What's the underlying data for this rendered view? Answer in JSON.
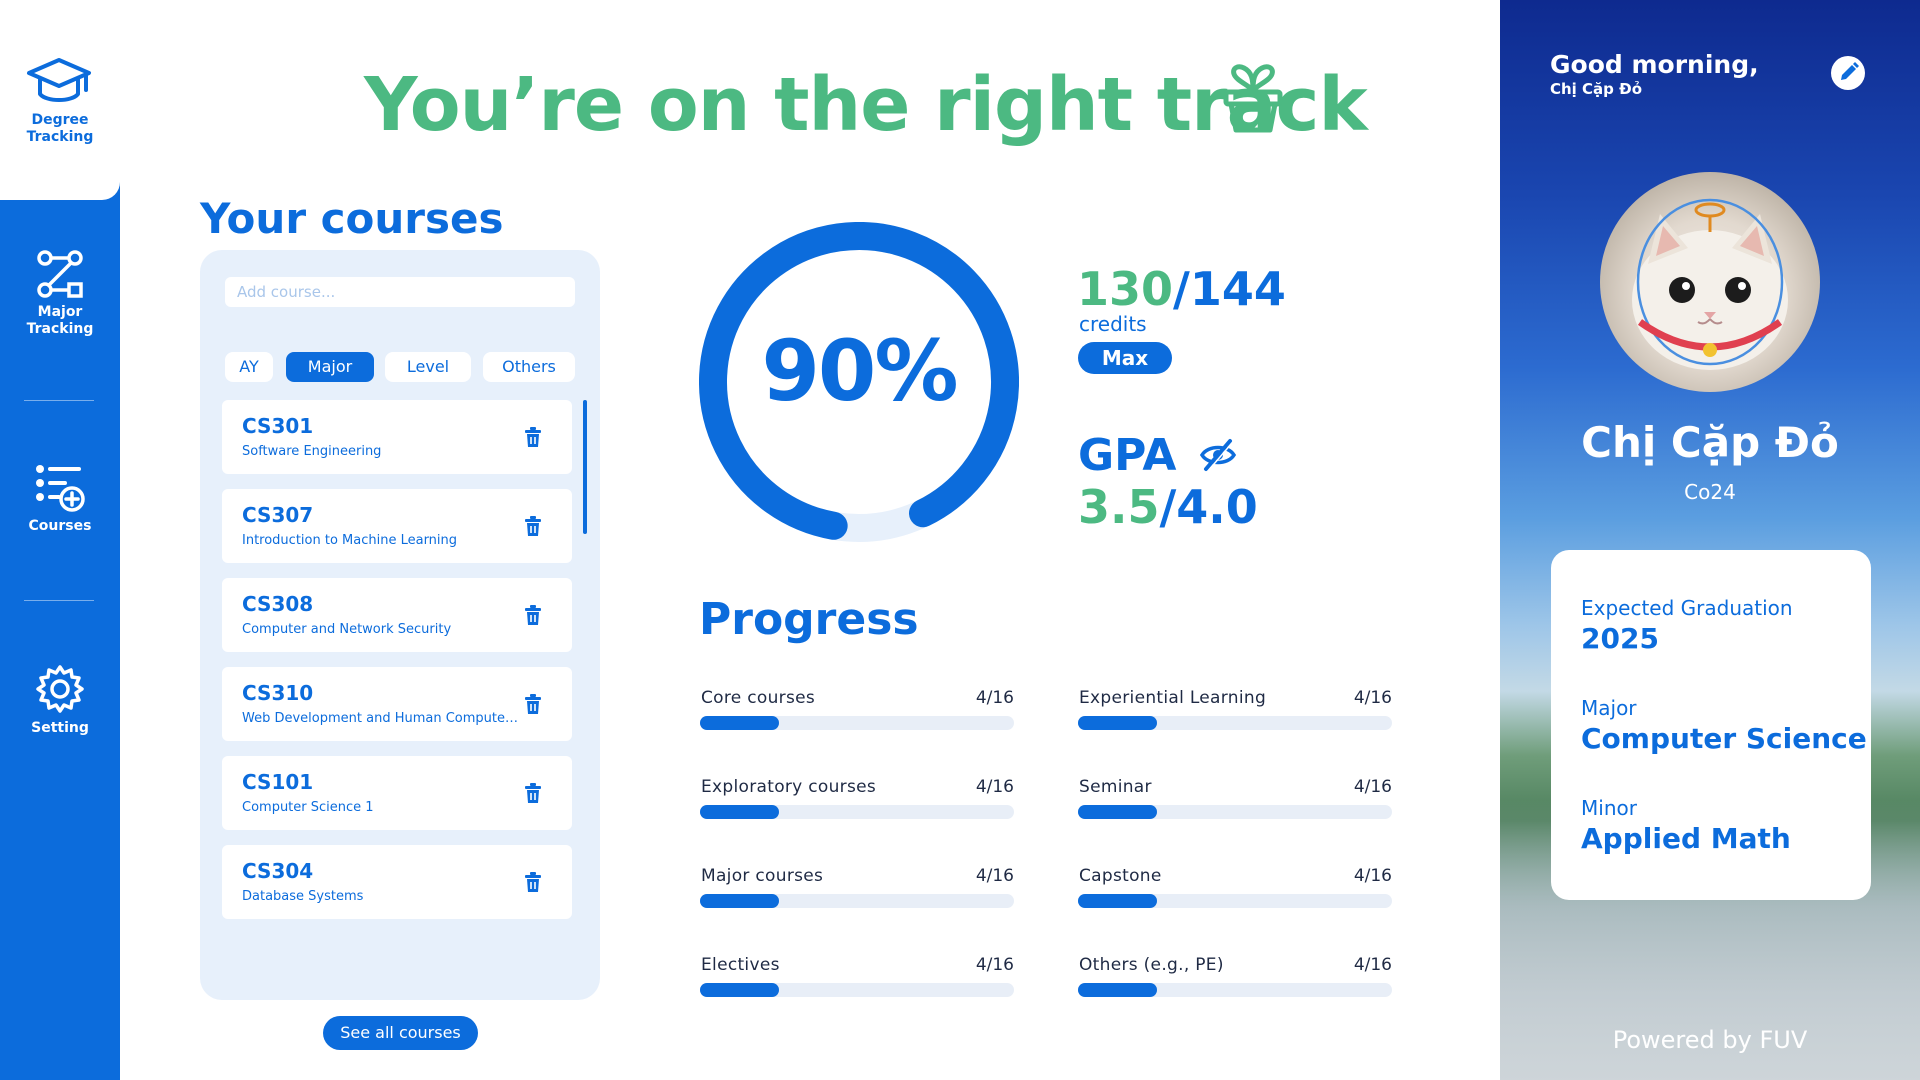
{
  "app": {
    "brand_label": "Degree\nTracking",
    "accent_color": "#0c6cdc",
    "success_color": "#4cb982"
  },
  "sidebar": {
    "items": [
      {
        "label": "Major\nTracking",
        "icon": "major-tracking-icon"
      },
      {
        "label": "Courses",
        "icon": "courses-icon"
      },
      {
        "label": "Setting",
        "icon": "gear-icon"
      }
    ]
  },
  "hero": {
    "title": "You’re on the right track",
    "icon": "plant-pot-icon"
  },
  "courses": {
    "title": "Your courses",
    "add_placeholder": "Add course...",
    "filters": [
      "AY",
      "Major",
      "Level",
      "Others"
    ],
    "active_filter": "Major",
    "items": [
      {
        "code": "CS301",
        "name": "Software Engineering"
      },
      {
        "code": "CS307",
        "name": "Introduction to Machine Learning"
      },
      {
        "code": "CS308",
        "name": "Computer and Network Security"
      },
      {
        "code": "CS310",
        "name": "Web Development and Human Computer Interaction"
      },
      {
        "code": "CS101",
        "name": "Computer Science 1"
      },
      {
        "code": "CS304",
        "name": "Database Systems"
      }
    ],
    "see_all_label": "See all courses"
  },
  "stats": {
    "completion_percent": 90,
    "completion_label": "90%",
    "credits_earned": "130",
    "credits_total": "/144",
    "credits_label": "credits",
    "max_label": "Max",
    "gpa_label": "GPA",
    "gpa_value": "3.5",
    "gpa_max": "/4.0"
  },
  "progress": {
    "title": "Progress",
    "items": [
      {
        "label": "Core courses",
        "count": "4/16",
        "fraction": 0.25
      },
      {
        "label": "Experiential Learning",
        "count": "4/16",
        "fraction": 0.25
      },
      {
        "label": "Exploratory courses",
        "count": "4/16",
        "fraction": 0.25
      },
      {
        "label": "Seminar",
        "count": "4/16",
        "fraction": 0.25
      },
      {
        "label": "Major courses",
        "count": "4/16",
        "fraction": 0.25
      },
      {
        "label": "Capstone",
        "count": "4/16",
        "fraction": 0.25
      },
      {
        "label": "Electives",
        "count": "4/16",
        "fraction": 0.25
      },
      {
        "label": "Others (e.g., PE)",
        "count": "4/16",
        "fraction": 0.25
      }
    ]
  },
  "profile": {
    "greeting": "Good morning,",
    "greeting_name": "Chị Cặp Đỏ",
    "name": "Chị Cặp Đỏ",
    "cohort": "Co24",
    "details": [
      {
        "label": "Expected Graduation",
        "value": "2025"
      },
      {
        "label": "Major",
        "value": "Computer Science"
      },
      {
        "label": "Minor",
        "value": "Applied Math"
      }
    ],
    "footer": "Powered by FUV"
  }
}
